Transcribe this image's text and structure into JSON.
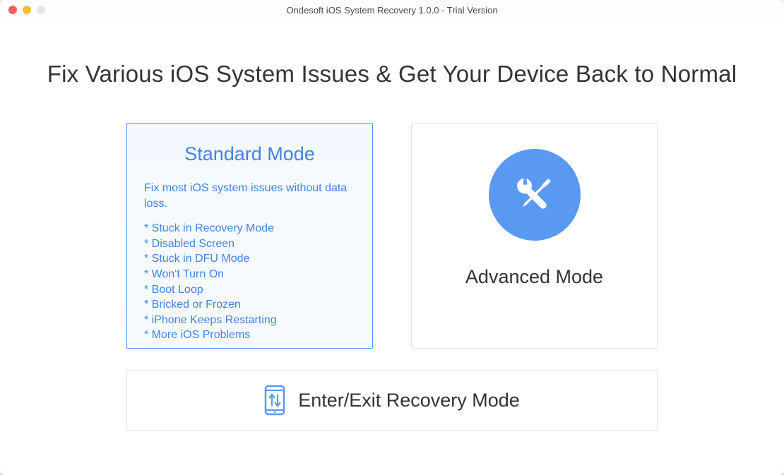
{
  "window": {
    "title": "Ondesoft iOS System Recovery 1.0.0 - Trial Version"
  },
  "headline": "Fix Various iOS System Issues & Get Your Device Back to Normal",
  "standard": {
    "title": "Standard Mode",
    "description": "Fix most iOS system issues without data loss.",
    "items": [
      "Stuck in Recovery Mode",
      "Disabled Screen",
      "Stuck in DFU Mode",
      "Won't Turn On",
      "Boot Loop",
      "Bricked or Frozen",
      "iPhone Keeps Restarting",
      "More iOS Problems"
    ]
  },
  "advanced": {
    "title": "Advanced Mode"
  },
  "recovery": {
    "label": "Enter/Exit Recovery Mode"
  },
  "colors": {
    "accent": "#5a99f2",
    "selected_border": "#4f94f6",
    "text_dark": "#333333",
    "text_blue": "#3f83e8"
  }
}
